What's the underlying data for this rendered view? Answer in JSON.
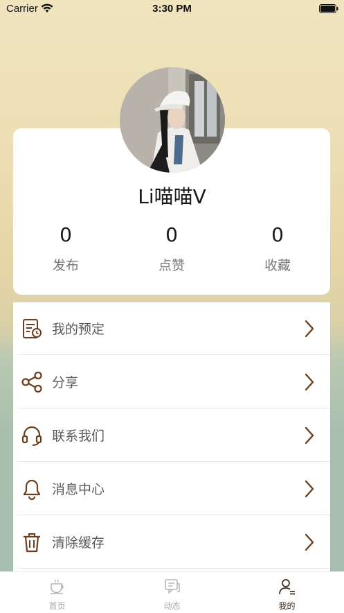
{
  "status_bar": {
    "carrier": "Carrier",
    "time": "3:30 PM"
  },
  "profile": {
    "username": "Li喵喵V",
    "stats": [
      {
        "value": "0",
        "label": "发布"
      },
      {
        "value": "0",
        "label": "点赞"
      },
      {
        "value": "0",
        "label": "收藏"
      }
    ]
  },
  "menu": {
    "items": [
      {
        "label": "我的预定",
        "icon": "booking-icon"
      },
      {
        "label": "分享",
        "icon": "share-icon"
      },
      {
        "label": "联系我们",
        "icon": "headset-icon"
      },
      {
        "label": "消息中心",
        "icon": "bell-icon"
      },
      {
        "label": "清除缓存",
        "icon": "trash-icon"
      }
    ]
  },
  "tab_bar": {
    "tabs": [
      {
        "label": "首页",
        "icon": "coffee-cup-icon",
        "active": false
      },
      {
        "label": "动态",
        "icon": "chat-icon",
        "active": false
      },
      {
        "label": "我的",
        "icon": "user-icon",
        "active": true
      }
    ]
  },
  "colors": {
    "accent": "#6b3f1d",
    "tab_active": "#3b2b1a",
    "tab_inactive": "#a8a8a8",
    "menu_text": "#5a5a5a"
  }
}
